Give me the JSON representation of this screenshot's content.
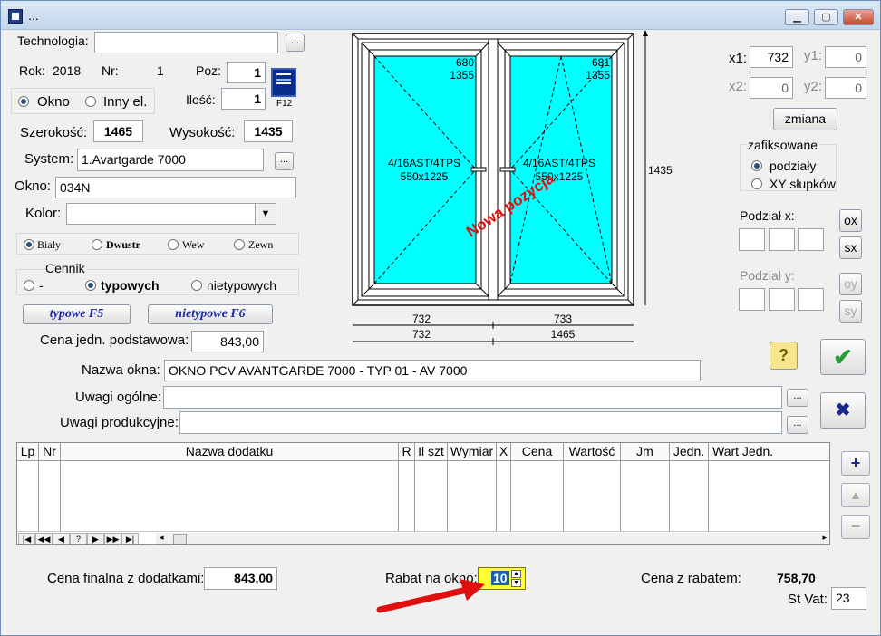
{
  "window": {
    "title": "..."
  },
  "left": {
    "technologia_label": "Technologia:",
    "technologia_value": "",
    "rok_label": "Rok:",
    "rok_value": "2018",
    "nr_label": "Nr:",
    "nr_value": "1",
    "poz_label": "Poz:",
    "poz_value": "1",
    "ilosc_label": "Ilość:",
    "ilosc_value": "1",
    "f12_label": "F12",
    "okno_radio": "Okno",
    "inny_radio": "Inny el.",
    "szer_label": "Szerokość:",
    "szer_value": "1465",
    "wys_label": "Wysokość:",
    "wys_value": "1435",
    "system_label": "System:",
    "system_value": "1.Avartgarde 7000",
    "okno_label": "Okno:",
    "okno_value": "034N",
    "kolor_label": "Kolor:",
    "kolor_value": "",
    "colors": [
      "Biały",
      "Dwustr",
      "Wew",
      "Zewn"
    ],
    "cennik_label": "Cennik",
    "cennik_options": [
      "-",
      "typowych",
      "nietypowych"
    ],
    "typowe_btn": "typowe F5",
    "nietypowe_btn": "nietypowe F6",
    "cena_jedn_label": "Cena jedn. podstawowa:",
    "cena_jedn_value": "843,00"
  },
  "drawing": {
    "left_sash": {
      "top_w": "680",
      "top_h": "1355",
      "glass": "4/16AST/4TPS",
      "size": "550x1225"
    },
    "right_sash": {
      "top_w": "681",
      "top_h": "1355",
      "glass": "4/16AST/4TPS",
      "size": "550x1225"
    },
    "height_dim": "1435",
    "dims_row1": [
      "732",
      "733"
    ],
    "dims_row2": [
      "732",
      "1465"
    ],
    "stamp": "Nowa pozycja"
  },
  "right": {
    "x1_label": "x1:",
    "x1_value": "732",
    "y1_label": "y1:",
    "y1_value": "0",
    "x2_label": "x2:",
    "x2_value": "0",
    "y2_label": "y2:",
    "y2_value": "0",
    "zmiana_btn": "zmiana",
    "zafiks_label": "zafiksowane",
    "zafiks_options": [
      "podziały",
      "XY słupków"
    ],
    "podzial_x_label": "Podział x:",
    "podzial_y_label": "Podział y:",
    "ox": "ox",
    "sx": "sx",
    "oy": "oy",
    "sy": "sy",
    "help_btn": "?"
  },
  "names": {
    "nazwa_label": "Nazwa okna:",
    "nazwa_value": "OKNO PCV AVANTGARDE 7000 - TYP 01 - AV 7000",
    "uwagi_og_label": "Uwagi ogólne:",
    "uwagi_og_value": "",
    "uwagi_prod_label": "Uwagi produkcyjne:",
    "uwagi_prod_value": ""
  },
  "table": {
    "columns": [
      "Lp",
      "Nr",
      "Nazwa dodatku",
      "R",
      "Il szt",
      "Wymiar",
      "X",
      "Cena",
      "Wartość",
      "Jm",
      "Jedn.",
      "Wart Jedn."
    ],
    "nav": [
      "|◀",
      "◀◀",
      "◀",
      "?",
      "▶",
      "▶▶",
      "▶|"
    ]
  },
  "footer": {
    "cena_finalna_label": "Cena finalna z dodatkami:",
    "cena_finalna_value": "843,00",
    "rabat_label": "Rabat na okno:",
    "rabat_value": "10",
    "cena_rabat_label": "Cena z rabatem:",
    "cena_rabat_value": "758,70",
    "stvat_label": "St Vat:",
    "stvat_value": "23"
  },
  "colors": {
    "glass": "#00ffff",
    "accent": "#1a5fb4",
    "stamp": "#dd1111",
    "highlight": "#ffff33",
    "ok": "#2a9d3a",
    "cancel": "#1a2a8c"
  }
}
